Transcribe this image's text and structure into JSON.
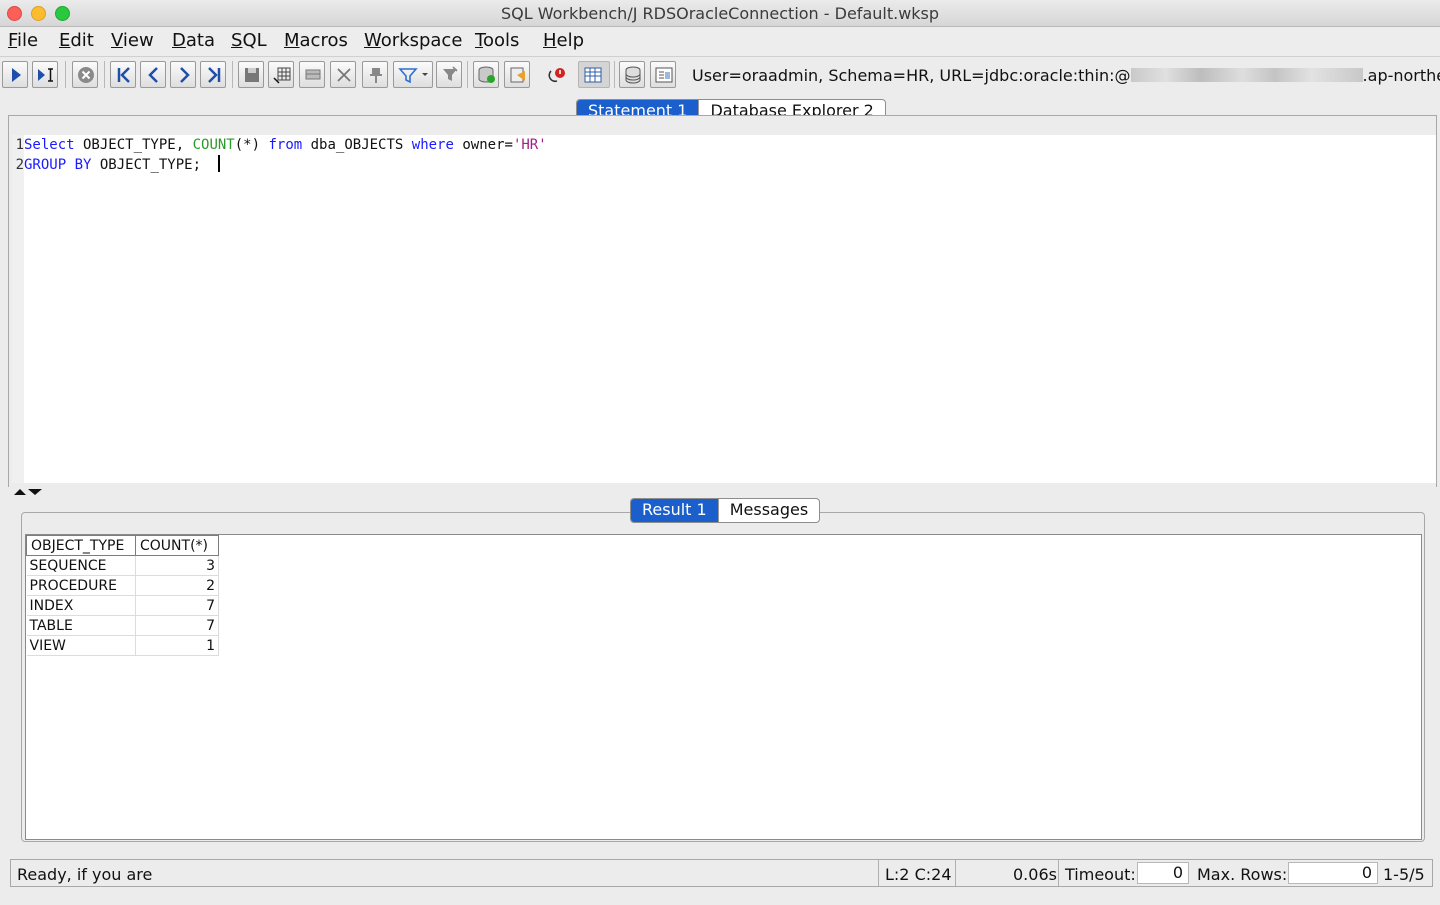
{
  "window": {
    "title": "SQL Workbench/J RDSOracleConnection - Default.wksp"
  },
  "menu": [
    "File",
    "Edit",
    "View",
    "Data",
    "SQL",
    "Macros",
    "Workspace",
    "Tools",
    "Help"
  ],
  "toolbar": {
    "connection_prefix": "User=oraadmin, Schema=HR, URL=jdbc:oracle:thin:@",
    "connection_suffix": ".ap-northeast-"
  },
  "editor_tabs": [
    {
      "label": "Statement 1",
      "active": true
    },
    {
      "label": "Database Explorer 2",
      "active": false
    }
  ],
  "editor": {
    "line_numbers": [
      "1",
      "2"
    ],
    "line1": {
      "kw1": "Select",
      "t1": " OBJECT_TYPE, ",
      "fn": "COUNT",
      "t2": "(*) ",
      "kw2": "from",
      "t3": " dba_OBJECTS ",
      "kw3": "where",
      "t4": " owner=",
      "str": "'HR'"
    },
    "line2": {
      "kw1": "GROUP BY",
      "t1": " OBJECT_TYPE;  "
    }
  },
  "result_tabs": [
    {
      "label": "Result 1",
      "active": true
    },
    {
      "label": "Messages",
      "active": false
    }
  ],
  "result": {
    "columns": [
      "OBJECT_TYPE",
      "COUNT(*)"
    ],
    "rows": [
      [
        "SEQUENCE",
        "3"
      ],
      [
        "PROCEDURE",
        "2"
      ],
      [
        "INDEX",
        "7"
      ],
      [
        "TABLE",
        "7"
      ],
      [
        "VIEW",
        "1"
      ]
    ]
  },
  "status": {
    "message": "Ready, if you are",
    "cursor": "L:2 C:24",
    "time": "0.06s",
    "timeout_label": "Timeout:",
    "timeout_value": "0",
    "maxrows_label": "Max. Rows:",
    "maxrows_value": "0",
    "row_range": "1-5/5"
  },
  "colors": {
    "active_tab": "#1a5fcb",
    "keyword": "#1a1aff",
    "function": "#2a9a2a",
    "string": "#a0208a"
  }
}
